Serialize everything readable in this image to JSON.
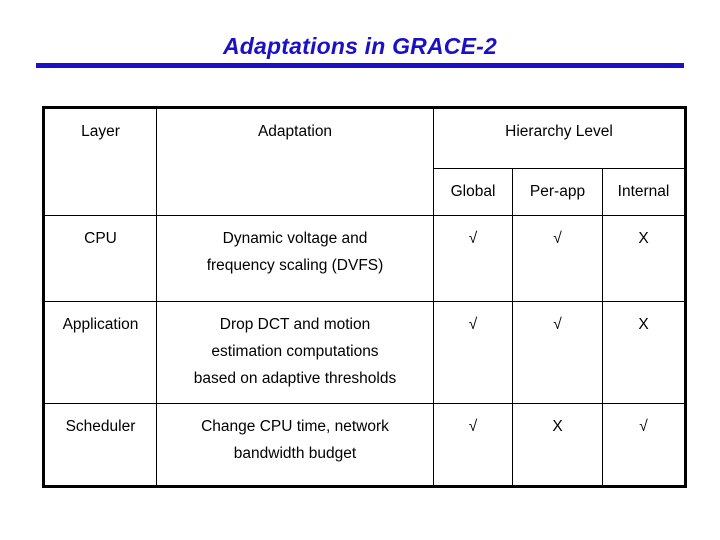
{
  "slide": {
    "title": "Adaptations in GRACE-2",
    "title_color": "#1a10c8",
    "rule_color": "#1a10c8",
    "background": "#ffffff"
  },
  "table": {
    "header": {
      "layer": "Layer",
      "adaptation": "Adaptation",
      "hierarchy": "Hierarchy Level",
      "sub": {
        "global": "Global",
        "per_app": "Per-app",
        "internal": "Internal"
      }
    },
    "marks": {
      "yes": "√",
      "no": "X",
      "yes_color": "#2c7d2c",
      "no_color": "#000000"
    },
    "rows": [
      {
        "layer": "CPU",
        "adaptation_lines": [
          "Dynamic voltage and",
          "frequency scaling (DVFS)"
        ],
        "global": "√",
        "per_app": "√",
        "internal": "X"
      },
      {
        "layer": "Application",
        "adaptation_lines": [
          "Drop DCT and motion",
          "estimation computations",
          "based on adaptive thresholds"
        ],
        "global": "√",
        "per_app": "√",
        "internal": "X"
      },
      {
        "layer": "Scheduler",
        "adaptation_lines": [
          "Change CPU time, network",
          "bandwidth budget"
        ],
        "global": "√",
        "per_app": "X",
        "internal": "√"
      }
    ]
  }
}
